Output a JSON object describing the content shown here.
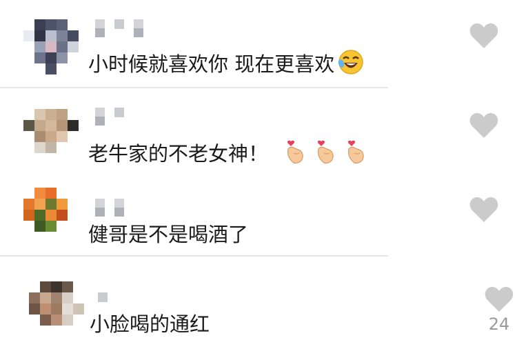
{
  "comments": [
    {
      "text": "小时候就喜欢你 现在更喜欢",
      "emoji": "rofl-emoji",
      "avatar_colors": [
        "#ffffff",
        "#3a3f52",
        "#4c5568",
        "#5b6278",
        "#ffffff",
        "#e9ebf0",
        "#2f3447",
        "#b9bfcf",
        "#7c839a",
        "#464c60",
        "#ffffff",
        "#9aa1b5",
        "#d8b7c4",
        "#6b7288",
        "#cfd3dd",
        "#ffffff",
        "#6d748a",
        "#3c4256",
        "#8c93a8",
        "#ffffff",
        "#ffffff",
        "#ffffff",
        "#4a5064",
        "#ffffff",
        "#ffffff"
      ]
    },
    {
      "text": "老牛家的不老女神！",
      "emoji": "finger-heart-emoji",
      "emoji_count": 3,
      "avatar_colors": [
        "#ffffff",
        "#d8c6ae",
        "#c9b093",
        "#bfa284",
        "#ffffff",
        "#5b5747",
        "#c4a98a",
        "#d4b89a",
        "#b69476",
        "#2d2b27",
        "#ffffff",
        "#a98d70",
        "#caa88a",
        "#e0c7ae",
        "#ffffff",
        "#ffffff",
        "#dcd6cf",
        "#c3b6a6",
        "#ffffff",
        "#ffffff",
        "#ffffff",
        "#ffffff",
        "#ffffff",
        "#ffffff",
        "#ffffff"
      ]
    },
    {
      "text": "健哥是不是喝酒了",
      "emoji": "",
      "avatar_colors": [
        "#ffffff",
        "#f08a3e",
        "#e86c2a",
        "#ffffff",
        "#ffffff",
        "#e3792f",
        "#f2a24e",
        "#6b7a2e",
        "#f09a3c",
        "#ffffff",
        "#d4651f",
        "#4f6b26",
        "#eb8a33",
        "#c24e1c",
        "#ffffff",
        "#ffffff",
        "#3f5a22",
        "#6a8c35",
        "#ffffff",
        "#ffffff",
        "#ffffff",
        "#ffffff",
        "#ffffff",
        "#ffffff",
        "#ffffff"
      ]
    },
    {
      "text": "小脸喝的通红",
      "emoji": "",
      "like_count": "24",
      "avatar_colors": [
        "#ffffff",
        "#5d4a3c",
        "#3e342d",
        "#6b5a4b",
        "#ffffff",
        "#8c6e5a",
        "#c9a890",
        "#a08470",
        "#d9cfc6",
        "#ffffff",
        "#6e5546",
        "#bf8f74",
        "#9c7a64",
        "#e6ded6",
        "#cfc3b8",
        "#ffffff",
        "#7a5d4c",
        "#b88e76",
        "#d8cdc4",
        "#ffffff",
        "#ffffff",
        "#ffffff",
        "#ffffff",
        "#ffffff",
        "#ffffff"
      ]
    }
  ],
  "colors": {
    "like_heart": "#cbcbcb",
    "text": "#1a1a1a",
    "count": "#9a9a9a",
    "divider": "#e6e6e6"
  }
}
